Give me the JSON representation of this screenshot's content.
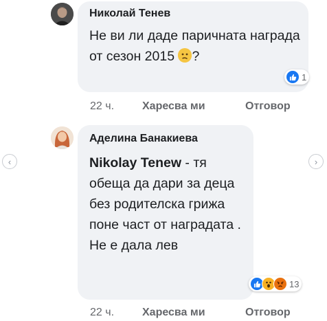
{
  "nav": {
    "prev_icon": "chevron-left-icon",
    "next_icon": "chevron-right-icon",
    "prev_glyph": "‹",
    "next_glyph": "›"
  },
  "comments": [
    {
      "author": "Николай Тенев",
      "text_before_emoji": "Не ви ли даде паричната награда от сезон 2015 ",
      "emoji": "confused-face-icon",
      "text_after_emoji": "?",
      "reactions": {
        "icons": [
          "like-icon"
        ],
        "count": "1"
      },
      "time": "22 ч.",
      "like_label": "Харесва ми",
      "reply_label": "Отговор"
    },
    {
      "author": "Аделина Банакиева",
      "mention": "Nikolay Tenew",
      "text": " - тя обеща да дари за деца без родителска грижа поне част от наградата . Не е дала лев",
      "reactions": {
        "icons": [
          "like-icon",
          "wow-icon",
          "angry-icon"
        ],
        "count": "13"
      },
      "time": "22 ч.",
      "like_label": "Харесва ми",
      "reply_label": "Отговор"
    }
  ],
  "colors": {
    "bubble": "#f0f2f5",
    "like_blue": "#1877f2",
    "meta_gray": "#65676b"
  }
}
